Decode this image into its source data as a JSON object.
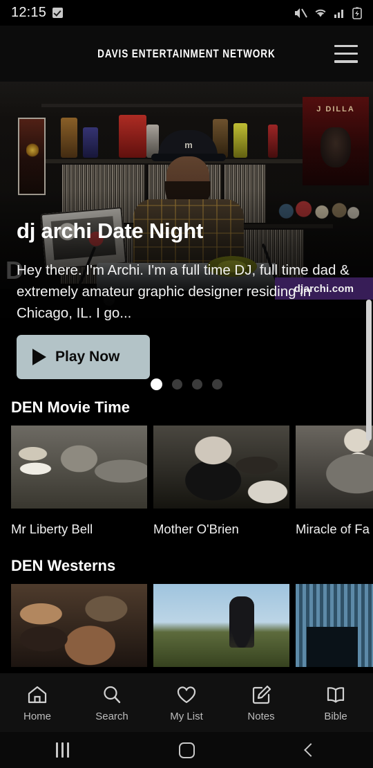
{
  "status_bar": {
    "time": "12:15",
    "icons": [
      "checkbox-icon",
      "mute-icon",
      "wifi-icon",
      "signal-icon",
      "battery-charging-icon"
    ]
  },
  "app_header": {
    "brand": "DAVIS ENTERTAINMENT NETWORK",
    "menu_icon": "hamburger-menu-icon"
  },
  "hero": {
    "title": "dj archi Date Night",
    "description": "Hey there. I'm Archi. I'm a full time DJ, full time dad & extremely amateur graphic designer residing in Chicago, IL.  I go...",
    "play_label": "Play Now",
    "play_icon": "play-triangle-icon",
    "watermark": "djarchi.com",
    "ghost_letter": "D",
    "carousel": {
      "total": 4,
      "active_index": 0
    },
    "button_bg": "#b3c3c7",
    "button_text_color": "#0b0b0b"
  },
  "rows": [
    {
      "title": "DEN Movie Time",
      "cards": [
        {
          "title": "Mr Liberty Bell",
          "art": "t-mrliberty"
        },
        {
          "title": "Mother O'Brien",
          "art": "t-mother"
        },
        {
          "title": "Miracle of Fa",
          "art": "t-miracle"
        }
      ]
    },
    {
      "title": "DEN Westerns",
      "cards": [
        {
          "title": "",
          "art": "t-west1"
        },
        {
          "title": "",
          "art": "t-west2"
        },
        {
          "title": "",
          "art": "t-west3"
        }
      ]
    }
  ],
  "bottom_nav": {
    "items": [
      {
        "label": "Home",
        "icon": "home-icon",
        "active": true
      },
      {
        "label": "Search",
        "icon": "search-icon",
        "active": false
      },
      {
        "label": "My List",
        "icon": "heart-icon",
        "active": false
      },
      {
        "label": "Notes",
        "icon": "note-edit-icon",
        "active": false
      },
      {
        "label": "Bible",
        "icon": "open-book-icon",
        "active": false
      }
    ]
  },
  "android_nav": {
    "recents_icon": "recents-icon",
    "home_icon": "home-square-icon",
    "back_icon": "back-chevron-icon"
  },
  "scrollbar": {
    "name": "vertical-scrollbar"
  },
  "theme": {
    "background": "#000000",
    "nav_background": "#111111",
    "text": "#ffffff"
  }
}
